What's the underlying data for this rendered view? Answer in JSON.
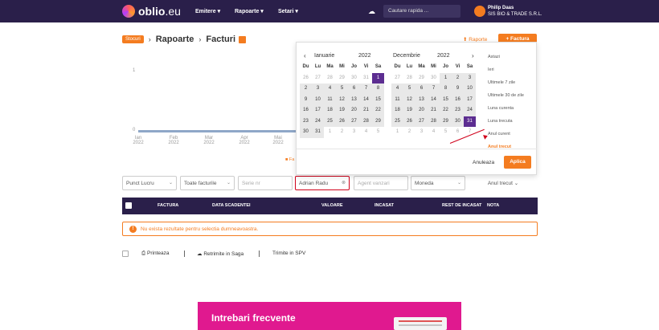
{
  "topbar": {
    "brand": "oblio",
    "brand_suffix": ".eu",
    "nav": [
      "Emitere",
      "Rapoarte",
      "Setari"
    ],
    "search_placeholder": "Cautare rapida ...",
    "user_name": "Philip Daas",
    "company": "SIS BIO & TRADE S.R.L."
  },
  "breadcrumb": {
    "tag": "Stocuri",
    "level1": "Rapoarte",
    "level2": "Facturi"
  },
  "header_actions": {
    "report": "Raporte",
    "add": "+ Factura"
  },
  "chart": {
    "y_ticks": [
      "1",
      "0"
    ],
    "x_ticks": [
      {
        "m": "Ian",
        "y": "2022"
      },
      {
        "m": "Feb",
        "y": "2022"
      },
      {
        "m": "Mar",
        "y": "2022"
      },
      {
        "m": "Apr",
        "y": "2022"
      },
      {
        "m": "Mai",
        "y": "2022"
      }
    ],
    "legend": "Fa"
  },
  "calendar": {
    "left": {
      "month": "Ianuarie",
      "year": "2022"
    },
    "right": {
      "month": "Decembrie",
      "year": "2022"
    },
    "weekdays": [
      "Du",
      "Lu",
      "Ma",
      "Mi",
      "Jo",
      "Vi",
      "Sa"
    ],
    "left_days": [
      {
        "d": "26",
        "s": "out"
      },
      {
        "d": "27",
        "s": "out"
      },
      {
        "d": "28",
        "s": "out"
      },
      {
        "d": "29",
        "s": "out"
      },
      {
        "d": "30",
        "s": "out"
      },
      {
        "d": "31",
        "s": "out"
      },
      {
        "d": "1",
        "s": "sel"
      },
      {
        "d": "2",
        "s": "in"
      },
      {
        "d": "3",
        "s": "in"
      },
      {
        "d": "4",
        "s": "in"
      },
      {
        "d": "5",
        "s": "in"
      },
      {
        "d": "6",
        "s": "in"
      },
      {
        "d": "7",
        "s": "in"
      },
      {
        "d": "8",
        "s": "in"
      },
      {
        "d": "9",
        "s": "in"
      },
      {
        "d": "10",
        "s": "in"
      },
      {
        "d": "11",
        "s": "in"
      },
      {
        "d": "12",
        "s": "in"
      },
      {
        "d": "13",
        "s": "in"
      },
      {
        "d": "14",
        "s": "in"
      },
      {
        "d": "15",
        "s": "in"
      },
      {
        "d": "16",
        "s": "in"
      },
      {
        "d": "17",
        "s": "in"
      },
      {
        "d": "18",
        "s": "in"
      },
      {
        "d": "19",
        "s": "in"
      },
      {
        "d": "20",
        "s": "in"
      },
      {
        "d": "21",
        "s": "in"
      },
      {
        "d": "22",
        "s": "in"
      },
      {
        "d": "23",
        "s": "in"
      },
      {
        "d": "24",
        "s": "in"
      },
      {
        "d": "25",
        "s": "in"
      },
      {
        "d": "26",
        "s": "in"
      },
      {
        "d": "27",
        "s": "in"
      },
      {
        "d": "28",
        "s": "in"
      },
      {
        "d": "29",
        "s": "in"
      },
      {
        "d": "30",
        "s": "in"
      },
      {
        "d": "31",
        "s": "in"
      },
      {
        "d": "1",
        "s": "out"
      },
      {
        "d": "2",
        "s": "out"
      },
      {
        "d": "3",
        "s": "out"
      },
      {
        "d": "4",
        "s": "out"
      },
      {
        "d": "5",
        "s": "out"
      }
    ],
    "right_days": [
      {
        "d": "27",
        "s": "out"
      },
      {
        "d": "28",
        "s": "out"
      },
      {
        "d": "29",
        "s": "out"
      },
      {
        "d": "30",
        "s": "out"
      },
      {
        "d": "1",
        "s": "in"
      },
      {
        "d": "2",
        "s": "in"
      },
      {
        "d": "3",
        "s": "in"
      },
      {
        "d": "4",
        "s": "in"
      },
      {
        "d": "5",
        "s": "in"
      },
      {
        "d": "6",
        "s": "in"
      },
      {
        "d": "7",
        "s": "in"
      },
      {
        "d": "8",
        "s": "in"
      },
      {
        "d": "9",
        "s": "in"
      },
      {
        "d": "10",
        "s": "in"
      },
      {
        "d": "11",
        "s": "in"
      },
      {
        "d": "12",
        "s": "in"
      },
      {
        "d": "13",
        "s": "in"
      },
      {
        "d": "14",
        "s": "in"
      },
      {
        "d": "15",
        "s": "in"
      },
      {
        "d": "16",
        "s": "in"
      },
      {
        "d": "17",
        "s": "in"
      },
      {
        "d": "18",
        "s": "in"
      },
      {
        "d": "19",
        "s": "in"
      },
      {
        "d": "20",
        "s": "in"
      },
      {
        "d": "21",
        "s": "in"
      },
      {
        "d": "22",
        "s": "in"
      },
      {
        "d": "23",
        "s": "in"
      },
      {
        "d": "24",
        "s": "in"
      },
      {
        "d": "25",
        "s": "in"
      },
      {
        "d": "26",
        "s": "in"
      },
      {
        "d": "27",
        "s": "in"
      },
      {
        "d": "28",
        "s": "in"
      },
      {
        "d": "29",
        "s": "in"
      },
      {
        "d": "30",
        "s": "in"
      },
      {
        "d": "31",
        "s": "sel"
      },
      {
        "d": "1",
        "s": "out"
      },
      {
        "d": "2",
        "s": "out"
      },
      {
        "d": "3",
        "s": "out"
      },
      {
        "d": "4",
        "s": "out"
      },
      {
        "d": "5",
        "s": "out"
      },
      {
        "d": "6",
        "s": "out"
      },
      {
        "d": "7",
        "s": "out"
      }
    ],
    "presets": [
      "Astazi",
      "Ieri",
      "Ultimele 7 zile",
      "Ultimele 30 de zile",
      "Luna curenta",
      "Luna trecuta",
      "Anul curent",
      "Anul trecut"
    ],
    "active_preset": "Anul trecut",
    "cancel": "Anuleaza",
    "apply": "Aplica"
  },
  "filters": {
    "punct_lucru": "Punct Lucru",
    "tip_facturi": "Toate facturile",
    "serie": "Serie nr",
    "client": "Adrian  Radu",
    "agent": "Agent vanzari",
    "moneda": "Moneda",
    "perioada": "Anul trecut"
  },
  "table": {
    "headers": [
      "FACTURA",
      "DATA SCADENTEI",
      "VALOARE",
      "INCASAT",
      "REST DE INCASAT",
      "NOTA"
    ]
  },
  "alert": {
    "icon": "!",
    "text": "Nu exista rezultate pentru selectia dumneavoastra."
  },
  "actions": {
    "print": "Printeaza",
    "saga": "Retrimite in Saga",
    "spv": "Trimite in SPV"
  },
  "faq": {
    "title": "Intrebari frecvente"
  }
}
